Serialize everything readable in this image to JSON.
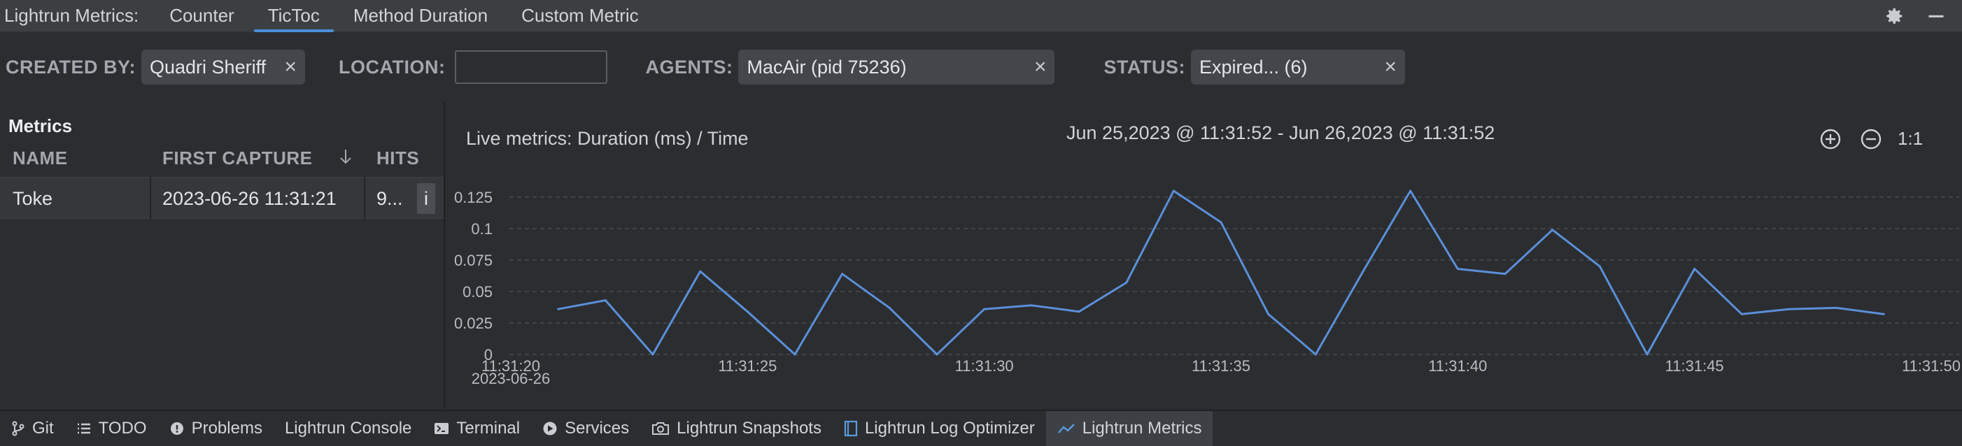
{
  "topbar": {
    "app_title": "Lightrun Metrics:",
    "tabs": [
      {
        "label": "Counter"
      },
      {
        "label": "TicToc"
      },
      {
        "label": "Method Duration"
      },
      {
        "label": "Custom Metric"
      }
    ]
  },
  "filters": {
    "created_by_label": "CREATED BY:",
    "created_by_value": "Quadri Sheriff",
    "location_label": "LOCATION:",
    "location_value": "",
    "agents_label": "AGENTS:",
    "agents_value": "MacAir (pid 75236)",
    "status_label": "STATUS:",
    "status_value": "Expired... (6)",
    "clear_glyph": "×"
  },
  "metrics": {
    "title": "Metrics",
    "columns": [
      "NAME",
      "FIRST CAPTURE",
      "HITS"
    ],
    "rows": [
      {
        "name": "Toke",
        "first_capture": "2023-06-26 11:31:21",
        "hits": "9...",
        "info": "i"
      }
    ]
  },
  "chart": {
    "title": "Live metrics: Duration (ms) / Time",
    "range": "Jun 25,2023 @ 11:31:52 - Jun 26,2023 @ 11:31:52",
    "ratio_label": "1:1"
  },
  "chart_data": {
    "type": "line",
    "title": "Live metrics: Duration (ms) / Time",
    "xlabel": "",
    "ylabel": "",
    "ylim": [
      0,
      0.14
    ],
    "xlim": [
      "11:31:20",
      "11:31:50"
    ],
    "grid": true,
    "y_ticks": [
      "0",
      "0.025",
      "0.05",
      "0.075",
      "0.1",
      "0.125"
    ],
    "x_ticks": [
      "11:31:20",
      "11:31:25",
      "11:31:30",
      "11:31:35",
      "11:31:40",
      "11:31:45",
      "11:31:50"
    ],
    "x_first_tick_date": "2023-06-26",
    "series": [
      {
        "color": "#5b8fd9",
        "points": [
          [
            "11:31:21",
            0.036
          ],
          [
            "11:31:22",
            0.043
          ],
          [
            "11:31:23",
            0.0
          ],
          [
            "11:31:24",
            0.066
          ],
          [
            "11:31:25",
            0.034
          ],
          [
            "11:31:26",
            0.0
          ],
          [
            "11:31:27",
            0.064
          ],
          [
            "11:31:28",
            0.037
          ],
          [
            "11:31:29",
            0.0
          ],
          [
            "11:31:30",
            0.036
          ],
          [
            "11:31:31",
            0.039
          ],
          [
            "11:31:32",
            0.034
          ],
          [
            "11:31:33",
            0.057
          ],
          [
            "11:31:34",
            0.13
          ],
          [
            "11:31:35",
            0.105
          ],
          [
            "11:31:36",
            0.032
          ],
          [
            "11:31:37",
            0.0
          ],
          [
            "11:31:38",
            0.066
          ],
          [
            "11:31:39",
            0.13
          ],
          [
            "11:31:40",
            0.068
          ],
          [
            "11:31:41",
            0.064
          ],
          [
            "11:31:42",
            0.099
          ],
          [
            "11:31:43",
            0.07
          ],
          [
            "11:31:44",
            0.0
          ],
          [
            "11:31:45",
            0.068
          ],
          [
            "11:31:46",
            0.032
          ],
          [
            "11:31:47",
            0.036
          ],
          [
            "11:31:48",
            0.037
          ],
          [
            "11:31:49",
            0.032
          ]
        ]
      }
    ]
  },
  "bottombar": {
    "tabs": [
      {
        "label": "Git",
        "icon": "branch-icon"
      },
      {
        "label": "TODO",
        "icon": "list-icon"
      },
      {
        "label": "Problems",
        "icon": "warning-icon"
      },
      {
        "label": "Lightrun Console",
        "icon": ""
      },
      {
        "label": "Terminal",
        "icon": "terminal-icon"
      },
      {
        "label": "Services",
        "icon": "services-icon"
      },
      {
        "label": "Lightrun Snapshots",
        "icon": "camera-icon"
      },
      {
        "label": "Lightrun Log Optimizer",
        "icon": "log-optimizer-icon"
      },
      {
        "label": "Lightrun Metrics",
        "icon": "chart-line-icon"
      }
    ]
  }
}
